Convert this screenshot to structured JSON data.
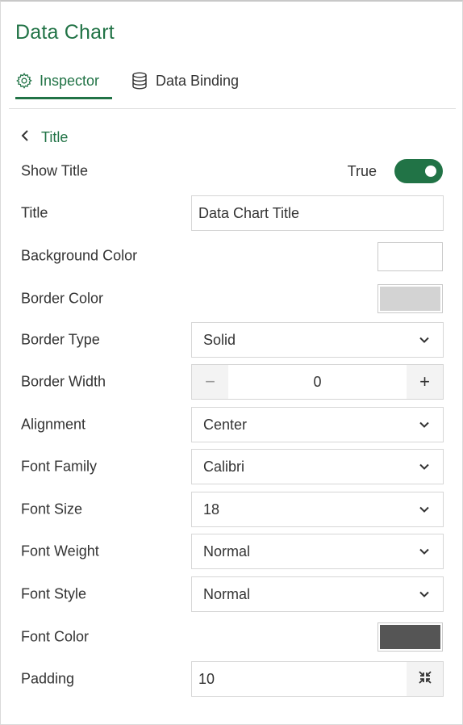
{
  "panel": {
    "title": "Data Chart"
  },
  "tabs": [
    {
      "label": "Inspector",
      "icon": "gear-icon",
      "active": true
    },
    {
      "label": "Data Binding",
      "icon": "database-icon",
      "active": false
    }
  ],
  "section": {
    "label": "Title"
  },
  "fields": {
    "show_title": {
      "label": "Show Title",
      "value": "True",
      "on": true
    },
    "title": {
      "label": "Title",
      "value": "Data Chart Title"
    },
    "background_color": {
      "label": "Background Color",
      "color": "#ffffff"
    },
    "border_color": {
      "label": "Border Color",
      "color": "#d3d3d3"
    },
    "border_type": {
      "label": "Border Type",
      "value": "Solid"
    },
    "border_width": {
      "label": "Border Width",
      "value": "0",
      "minus": "−",
      "plus": "+"
    },
    "alignment": {
      "label": "Alignment",
      "value": "Center"
    },
    "font_family": {
      "label": "Font Family",
      "value": "Calibri"
    },
    "font_size": {
      "label": "Font Size",
      "value": "18"
    },
    "font_weight": {
      "label": "Font Weight",
      "value": "Normal"
    },
    "font_style": {
      "label": "Font Style",
      "value": "Normal"
    },
    "font_color": {
      "label": "Font Color",
      "color": "#555555"
    },
    "padding": {
      "label": "Padding",
      "value": "10"
    }
  },
  "colors": {
    "accent": "#217346"
  }
}
